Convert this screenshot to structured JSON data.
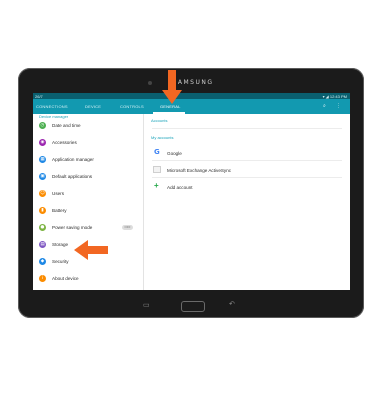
{
  "device": {
    "brand": "SAMSUNG"
  },
  "status": {
    "left": "26/7",
    "right": "▾ ◢ 12:43 PM"
  },
  "tabs": [
    {
      "label": "CONNECTIONS"
    },
    {
      "label": "DEVICE"
    },
    {
      "label": "CONTROLS"
    },
    {
      "label": "GENERAL"
    }
  ],
  "left_panel": {
    "section": "Device manager",
    "items": [
      {
        "label": "Date and time",
        "icon": "clock-icon",
        "color": "#4caf50"
      },
      {
        "label": "Accessories",
        "icon": "accessories-icon",
        "color": "#9c27b0"
      },
      {
        "label": "Application manager",
        "icon": "app-manager-icon",
        "color": "#1e88e5"
      },
      {
        "label": "Default applications",
        "icon": "default-apps-icon",
        "color": "#1e88e5"
      },
      {
        "label": "Users",
        "icon": "users-icon",
        "color": "#fb8c00"
      },
      {
        "label": "Battery",
        "icon": "battery-icon",
        "color": "#fb8c00"
      },
      {
        "label": "Power saving mode",
        "icon": "power-saving-icon",
        "color": "#7cb342",
        "toggle": "OFF"
      },
      {
        "label": "Storage",
        "icon": "storage-icon",
        "color": "#7e57c2"
      },
      {
        "label": "Security",
        "icon": "security-icon",
        "color": "#1e88e5"
      },
      {
        "label": "About device",
        "icon": "about-icon",
        "color": "#fb8c00"
      }
    ]
  },
  "right_panel": {
    "accounts_head": "Accounts",
    "my_accounts_head": "My accounts",
    "items": [
      {
        "label": "Google",
        "icon": "google-icon"
      },
      {
        "label": "Microsoft Exchange ActiveSync",
        "icon": "exchange-icon"
      },
      {
        "label": "Add account",
        "icon": "plus-icon"
      }
    ]
  },
  "colors": {
    "accent": "#1299b0",
    "arrow": "#f26722",
    "status_bar": "#0a5f6f"
  }
}
